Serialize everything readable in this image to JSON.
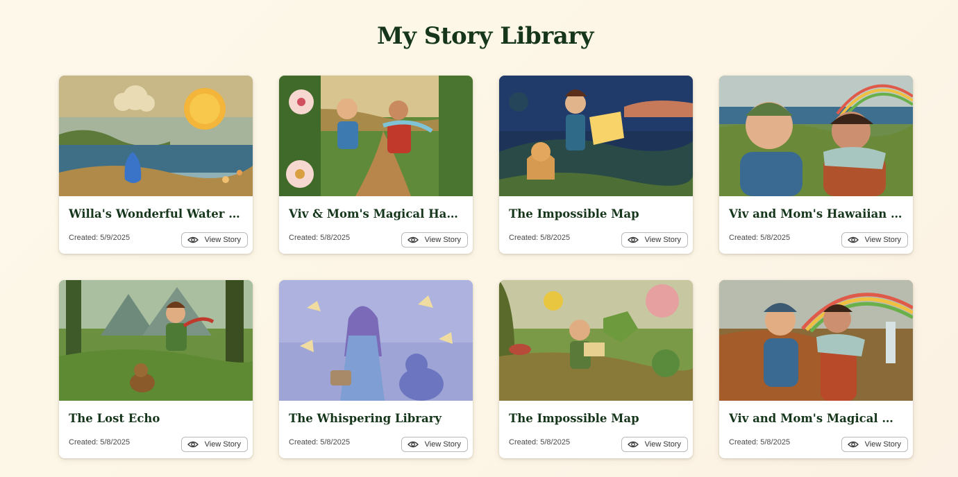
{
  "page": {
    "title": "My Story Library"
  },
  "stories": [
    {
      "title": "Willa's Wonderful Water Journey",
      "created": "Created: 5/9/2025",
      "action": "View Story",
      "image": "sun-cloud-water-drop-illustration"
    },
    {
      "title": "Viv & Mom's Magical Hawaiian Adventure",
      "created": "Created: 5/8/2025",
      "action": "View Story",
      "image": "boy-and-mom-running-through-flowers-illustration"
    },
    {
      "title": "The Impossible Map",
      "created": "Created: 5/8/2025",
      "action": "View Story",
      "image": "girl-with-glowing-map-and-cat-illustration"
    },
    {
      "title": "Viv and Mom's Hawaiian Adventure",
      "created": "Created: 5/8/2025",
      "action": "View Story",
      "image": "boy-and-mom-selfie-rainbow-illustration"
    },
    {
      "title": "The Lost Echo",
      "created": "Created: 5/8/2025",
      "action": "View Story",
      "image": "boy-and-beaver-in-forest-illustration"
    },
    {
      "title": "The Whispering Library",
      "created": "Created: 5/8/2025",
      "action": "View Story",
      "image": "girl-and-cat-in-magic-library-illustration"
    },
    {
      "title": "The Impossible Map",
      "created": "Created: 5/8/2025",
      "action": "View Story",
      "image": "boy-with-map-and-bird-floating-islands-illustration"
    },
    {
      "title": "Viv and Mom's Magical Hawaiian Adventure",
      "created": "Created: 5/8/2025",
      "action": "View Story",
      "image": "boy-and-mom-rainbow-waterfall-illustration"
    }
  ],
  "colors": {
    "title": "#16361c",
    "background": "#fdf7e8",
    "card": "#ffffff"
  },
  "icons": {
    "view": "eye-icon"
  }
}
